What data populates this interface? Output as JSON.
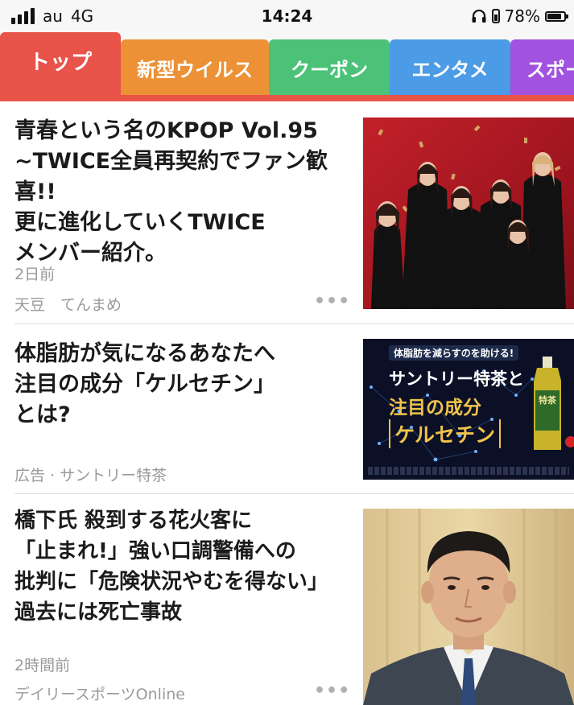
{
  "status_bar": {
    "carrier": "au",
    "network": "4G",
    "time": "14:24",
    "battery_percent": "78%",
    "battery_level": 0.78,
    "icons": [
      "signal-icon",
      "headphones-icon",
      "battery-icon"
    ]
  },
  "tabs": [
    {
      "label": "トップ",
      "color": "#e8534a",
      "active": true
    },
    {
      "label": "新型ウイルス",
      "color": "#ec9135"
    },
    {
      "label": "クーポン",
      "color": "#4bc278"
    },
    {
      "label": "エンタメ",
      "color": "#4c9be6"
    },
    {
      "label": "スポー",
      "color": "#a152de"
    }
  ],
  "articles": [
    {
      "title_lines": [
        "青春という名のKPOP Vol.95",
        "~TWICE全員再契約でファン歓喜!!",
        "更に進化していくTWICE",
        "メンバー紹介。"
      ],
      "time": "2日前",
      "source": "天豆　てんまめ",
      "more": "•••",
      "thumbnail": "group-photo"
    },
    {
      "title_lines": [
        "体脂肪が気になるあなたへ",
        "注目の成分「ケルセチン」",
        "とは?"
      ],
      "source": "広告 · サントリー特茶",
      "thumbnail": "ad-banner",
      "ad_banner": {
        "tagline": "体脂肪を減らすのを助ける!",
        "line1": "サントリー特茶と",
        "line2": "注目の成分",
        "line3": "ケルセチン",
        "bottle_label": "特茶"
      }
    },
    {
      "title_lines": [
        "橋下氏 殺到する花火客に",
        "「止まれ!」強い口調警備への",
        "批判に「危険状況やむを得ない」",
        "過去には死亡事故"
      ],
      "time": "2時間前",
      "source": "デイリースポーツOnline",
      "more": "•••",
      "thumbnail": "portrait-photo"
    }
  ]
}
